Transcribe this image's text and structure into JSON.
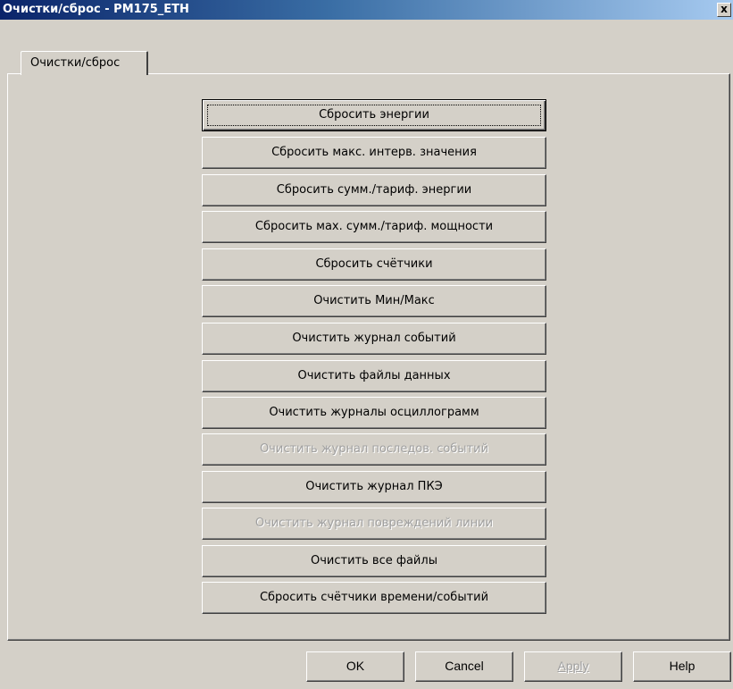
{
  "window": {
    "title": "Очистки/сброс - PM175_ETH",
    "close_label": "x"
  },
  "tabs": [
    {
      "label": "Очистки/сброс",
      "selected": true
    }
  ],
  "buttons": [
    {
      "label": "Сбросить энергии",
      "enabled": true,
      "default": true
    },
    {
      "label": "Сбросить макс. интерв. значения",
      "enabled": true
    },
    {
      "label": "Сбросить сумм./тариф. энергии",
      "enabled": true
    },
    {
      "label": "Сбросить мах. сумм./тариф. мощности",
      "enabled": true
    },
    {
      "label": "Сбросить счётчики",
      "enabled": true
    },
    {
      "label": "Очистить Мин/Макс",
      "enabled": true
    },
    {
      "label": "Очистить журнал событий",
      "enabled": true
    },
    {
      "label": "Очистить файлы данных",
      "enabled": true
    },
    {
      "label": "Очистить журналы осциллограмм",
      "enabled": true
    },
    {
      "label": "Очистить журнал последов. событий",
      "enabled": false
    },
    {
      "label": "Очистить журнал ПКЭ",
      "enabled": true
    },
    {
      "label": "Очистить журнал повреждений линии",
      "enabled": false
    },
    {
      "label": "Очистить все файлы",
      "enabled": true
    },
    {
      "label": "Сбросить счётчики времени/событий",
      "enabled": true
    }
  ],
  "footer": {
    "ok": "OK",
    "cancel": "Cancel",
    "apply": "Apply",
    "apply_enabled": false,
    "help": "Help"
  },
  "colors": {
    "face": "#d4d0c8",
    "title_start": "#0a246a",
    "title_end": "#a6caf0",
    "disabled_text": "#a0a0a0"
  }
}
